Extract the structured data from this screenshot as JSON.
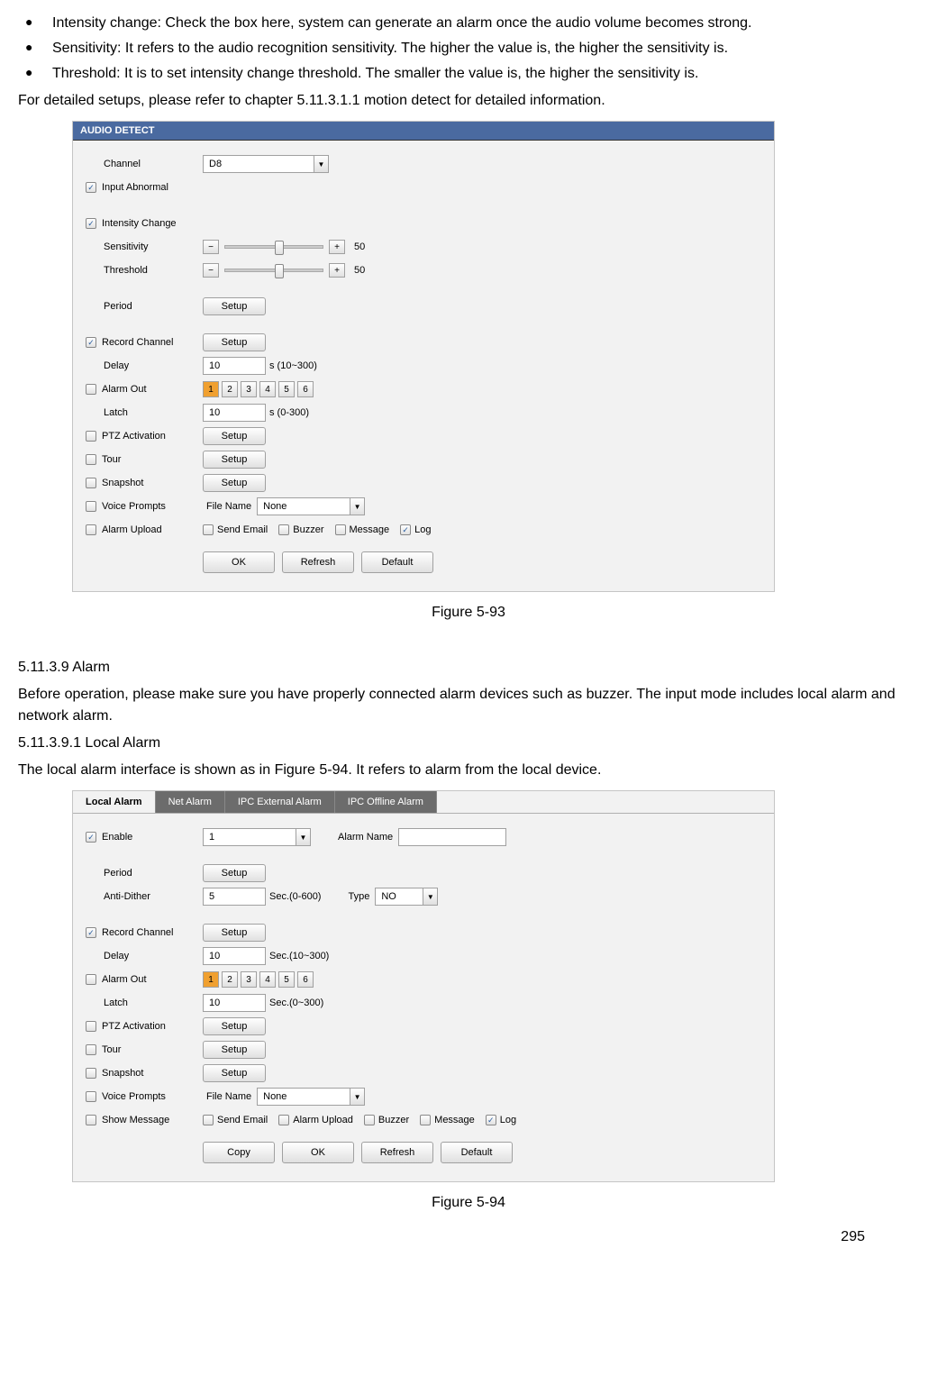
{
  "bullets": [
    "Intensity change: Check the box here, system can generate an alarm once the audio volume becomes strong.",
    "Sensitivity: It refers to the audio recognition sensitivity. The higher the value is, the higher the sensitivity is.",
    "Threshold: It is to set intensity change threshold. The smaller the value is, the higher the sensitivity is."
  ],
  "para1": "For detailed setups, please refer to chapter 5.11.3.1.1 motion detect for detailed information.",
  "fig1": {
    "title": "AUDIO DETECT",
    "caption": "Figure 5-93",
    "channel_label": "Channel",
    "channel_value": "D8",
    "input_abnormal": "Input Abnormal",
    "intensity_change": "Intensity Change",
    "sensitivity": "Sensitivity",
    "sensitivity_val": "50",
    "threshold": "Threshold",
    "threshold_val": "50",
    "period": "Period",
    "setup": "Setup",
    "record_channel": "Record Channel",
    "delay": "Delay",
    "delay_val": "10",
    "delay_suffix": "s (10~300)",
    "alarm_out": "Alarm Out",
    "latch": "Latch",
    "latch_val": "10",
    "latch_suffix": "s (0-300)",
    "ptz": "PTZ Activation",
    "tour": "Tour",
    "snapshot": "Snapshot",
    "voice": "Voice Prompts",
    "file_name": "File Name",
    "file_value": "None",
    "alarm_upload": "Alarm Upload",
    "send_email": "Send Email",
    "buzzer": "Buzzer",
    "message": "Message",
    "log": "Log",
    "ok": "OK",
    "refresh": "Refresh",
    "default": "Default",
    "nums": [
      "1",
      "2",
      "3",
      "4",
      "5",
      "6"
    ]
  },
  "sec_heading": "5.11.3.9  Alarm",
  "sec_para": "Before operation, please make sure you have properly connected alarm devices such as buzzer. The input mode includes local alarm and network alarm.",
  "sub_heading": "5.11.3.9.1   Local Alarm",
  "sub_para": "The local alarm interface is shown as in Figure 5-94. It refers to alarm from the local device.",
  "fig2": {
    "caption": "Figure 5-94",
    "tabs": [
      "Local Alarm",
      "Net Alarm",
      "IPC External Alarm",
      "IPC Offline Alarm"
    ],
    "enable": "Enable",
    "enable_val": "1",
    "alarm_name": "Alarm Name",
    "period": "Period",
    "setup": "Setup",
    "anti": "Anti-Dither",
    "anti_val": "5",
    "anti_suffix": "Sec.(0-600)",
    "type": "Type",
    "type_val": "NO",
    "record_channel": "Record Channel",
    "delay": "Delay",
    "delay_val": "10",
    "delay_suffix": "Sec.(10~300)",
    "alarm_out": "Alarm Out",
    "latch": "Latch",
    "latch_val": "10",
    "latch_suffix": "Sec.(0~300)",
    "ptz": "PTZ Activation",
    "tour": "Tour",
    "snapshot": "Snapshot",
    "voice": "Voice Prompts",
    "file_name": "File Name",
    "file_value": "None",
    "show_message": "Show Message",
    "send_email": "Send Email",
    "alarm_upload": "Alarm Upload",
    "buzzer": "Buzzer",
    "message": "Message",
    "log": "Log",
    "copy": "Copy",
    "ok": "OK",
    "refresh": "Refresh",
    "default": "Default",
    "nums": [
      "1",
      "2",
      "3",
      "4",
      "5",
      "6"
    ]
  },
  "page_number": "295"
}
